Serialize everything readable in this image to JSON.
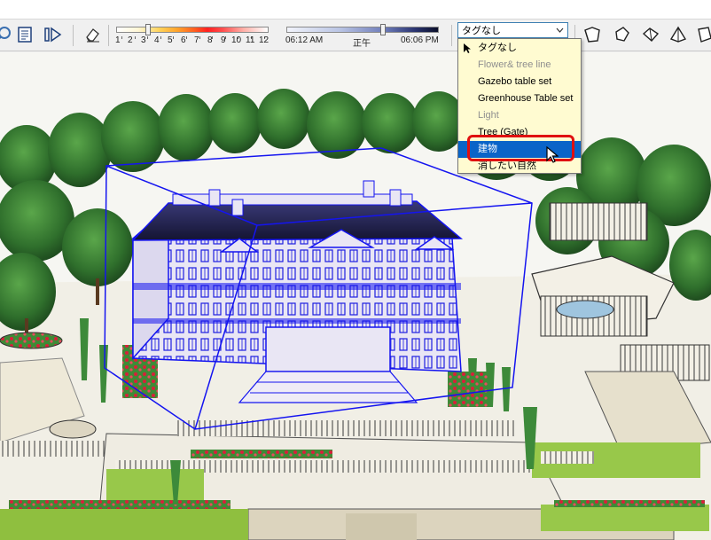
{
  "toolbar": {
    "month_slider": {
      "labels": [
        "1",
        "2",
        "3",
        "4",
        "5",
        "6",
        "7",
        "8",
        "9",
        "10",
        "11",
        "12"
      ],
      "value": 3.2
    },
    "time_slider": {
      "start_label": "06:12 AM",
      "mid_label": "正午",
      "end_label": "06:06 PM",
      "value": 0.62
    },
    "tag_select": {
      "selected": "タグなし"
    }
  },
  "tag_dropdown": {
    "items": [
      {
        "label": "タグなし",
        "visible": true,
        "current": true
      },
      {
        "label": "Flower& tree line",
        "visible": false
      },
      {
        "label": "Gazebo table set",
        "visible": true
      },
      {
        "label": "Greenhouse Table set",
        "visible": true
      },
      {
        "label": "Light",
        "visible": false
      },
      {
        "label": "Tree (Gate)",
        "visible": true
      },
      {
        "label": "建物",
        "visible": true,
        "hover": true
      },
      {
        "label": "消したい自然",
        "visible": true
      }
    ]
  },
  "colors": {
    "selection": "#1414f0",
    "highlight": "#e01010",
    "menu_hover": "#0a64c8",
    "menu_bg": "#fffbd1"
  }
}
